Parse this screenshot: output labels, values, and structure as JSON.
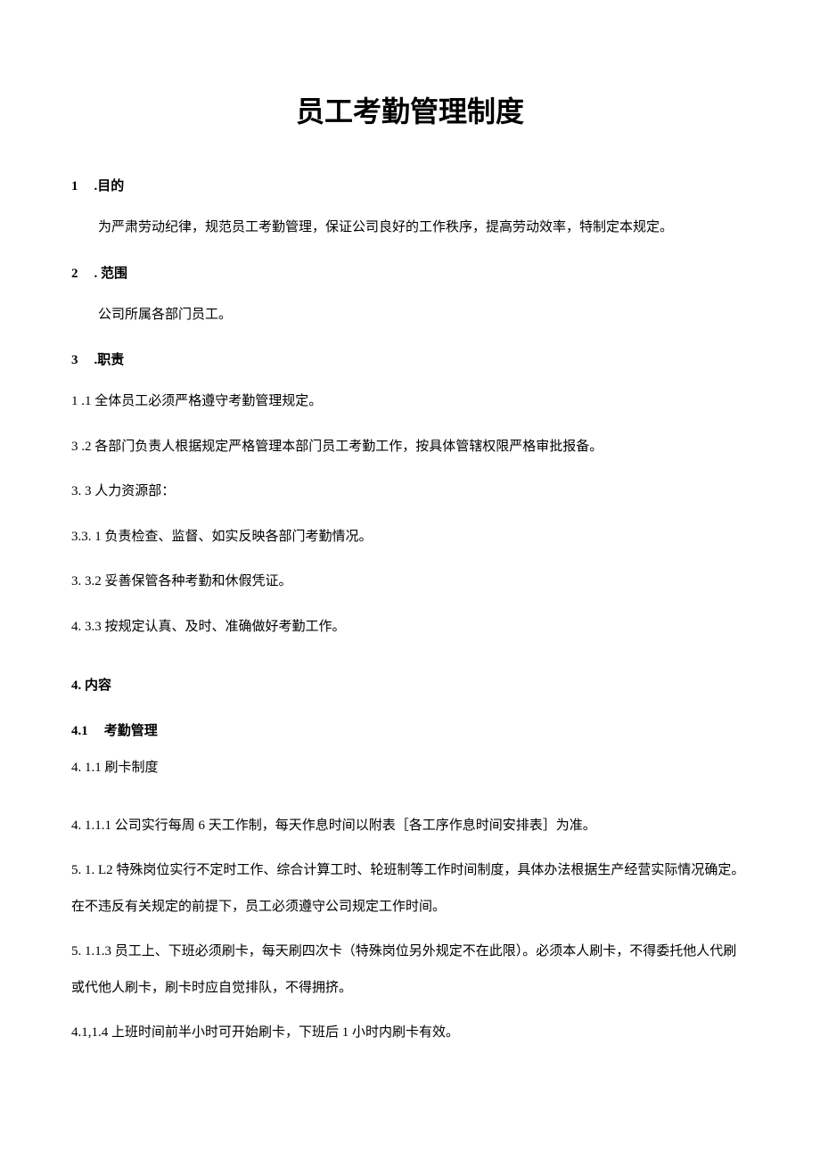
{
  "title": "员工考勤管理制度",
  "s1": {
    "num": "1",
    "label": ".目的",
    "p1": "为严肃劳动纪律，规范员工考勤管理，保证公司良好的工作秩序，提高劳动效率，特制定本规定。"
  },
  "s2": {
    "num": "2",
    "label": ". 范围",
    "p1": "公司所属各部门员工。"
  },
  "s3": {
    "num": "3",
    "label": ".职责",
    "p1": "1   .1 全体员工必须严格遵守考勤管理规定。",
    "p2": "3   .2 各部门负责人根据规定严格管理本部门员工考勤工作，按具体管辖权限严格审批报备。",
    "p3": "3.   3 人力资源部：",
    "p4": "3.3.   1 负责检查、监督、如实反映各部门考勤情况。",
    "p5": "3.   3.2 妥善保管各种考勤和休假凭证。",
    "p6": "4.   3.3 按规定认真、及时、准确做好考勤工作。"
  },
  "s4": {
    "heading": "4. 内容",
    "sub1": {
      "num": "4.1",
      "label": "考勤管理"
    },
    "p1": "4.   1.1 刷卡制度",
    "p2": "4.   1.1.1 公司实行每周 6 天工作制，每天作息时间以附表［各工序作息时间安排表］为准。",
    "p3": "5.   1. L2 特殊岗位实行不定时工作、综合计算工时、轮班制等工作时间制度，具体办法根据生产经营实际情况确定。",
    "p3b": "在不违反有关规定的前提下，员工必须遵守公司规定工作时间。",
    "p4": "5.   1.1.3 员工上、下班必须刷卡，每天刷四次卡（特殊岗位另外规定不在此限）。必须本人刷卡，不得委托他人代刷",
    "p4b": "或代他人刷卡，刷卡时应自觉排队，不得拥挤。",
    "p5": "4.1,1.4 上班时间前半小时可开始刷卡，下班后 1 小时内刷卡有效。"
  }
}
